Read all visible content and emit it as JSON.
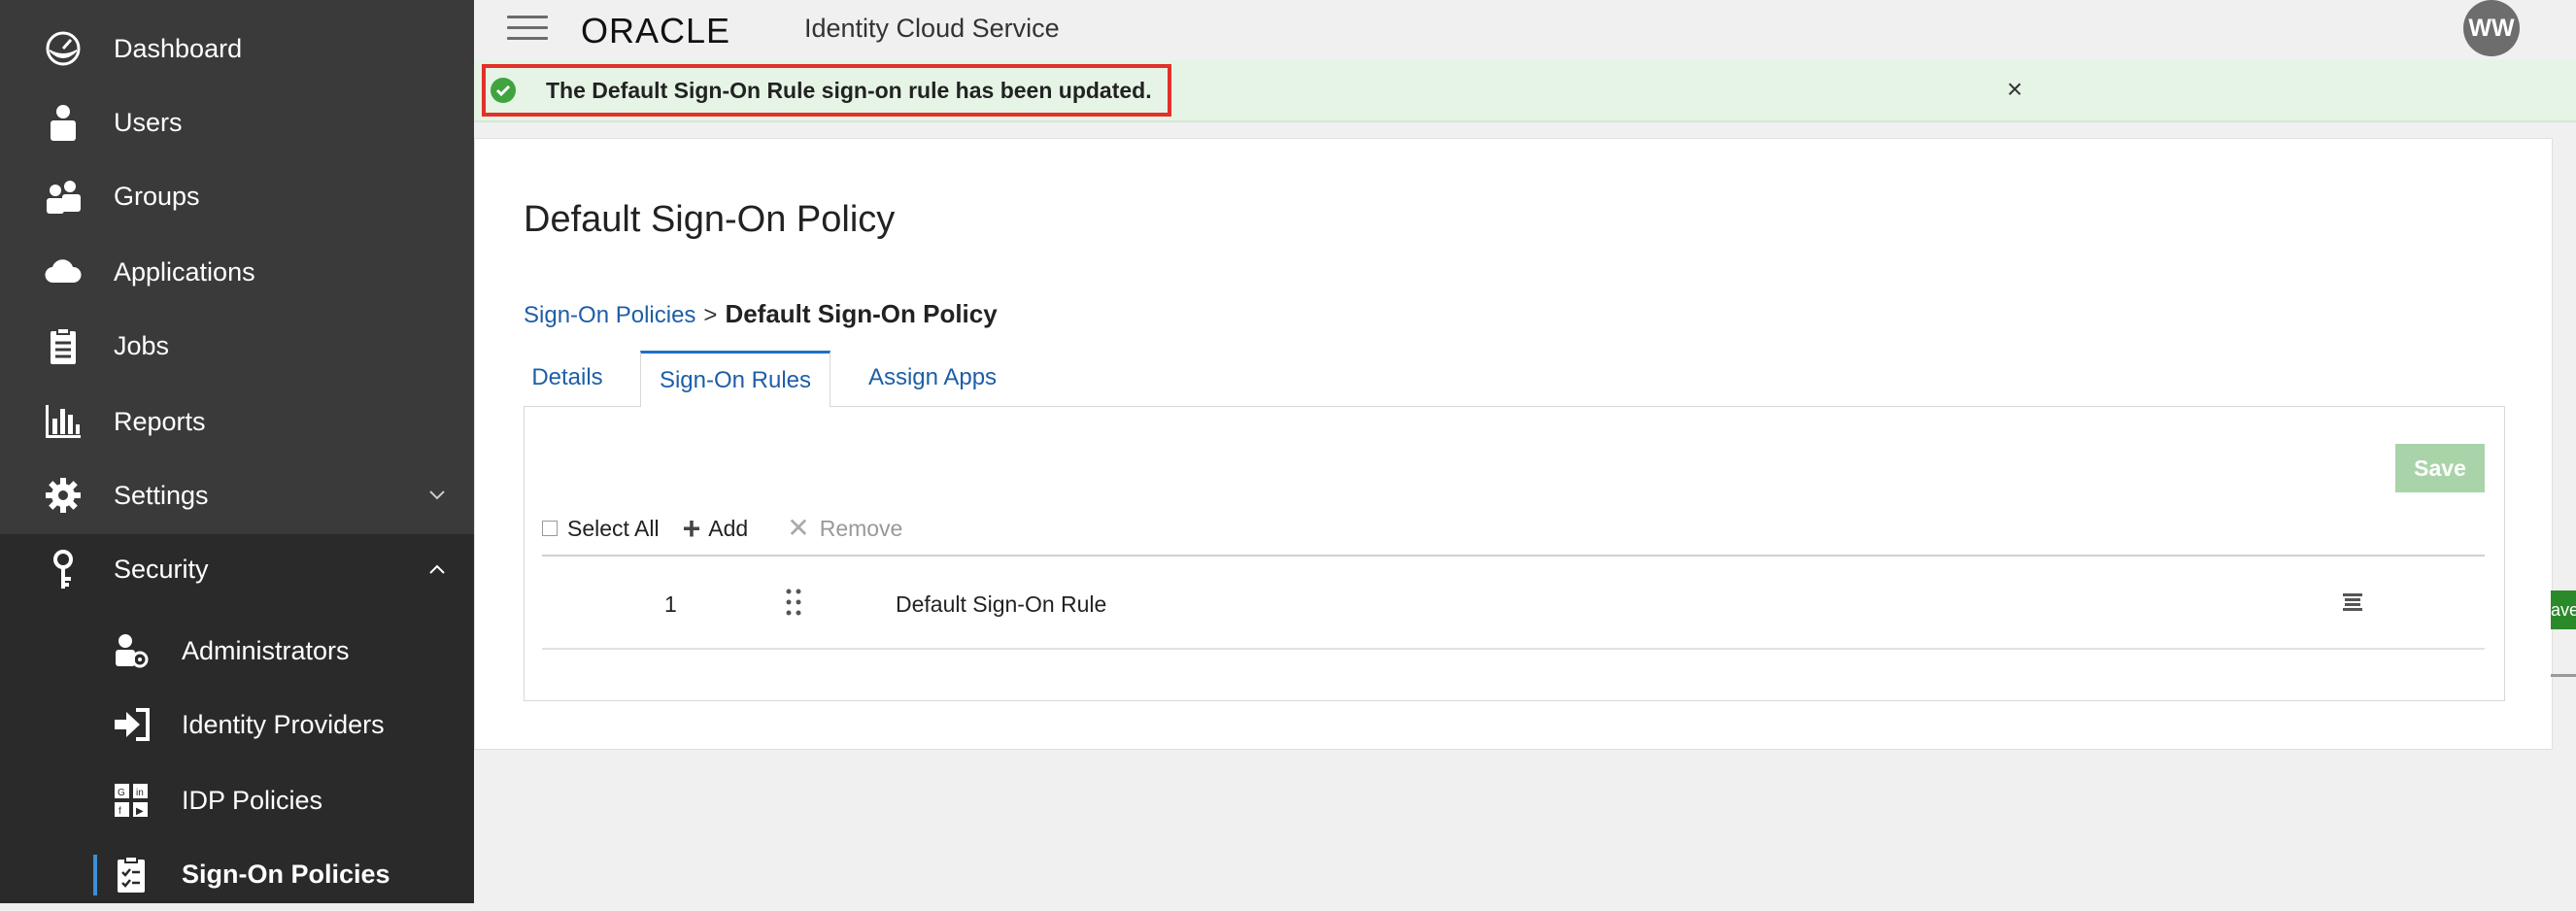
{
  "header": {
    "brand": "ORACLE",
    "app_name": "Identity Cloud Service",
    "avatar_initials": "WW"
  },
  "notification": {
    "message": "The Default Sign-On Rule sign-on rule has been updated.",
    "close": "×"
  },
  "sidebar": {
    "items": [
      {
        "label": "Dashboard",
        "icon": "dashboard-icon"
      },
      {
        "label": "Users",
        "icon": "user-icon"
      },
      {
        "label": "Groups",
        "icon": "groups-icon"
      },
      {
        "label": "Applications",
        "icon": "cloud-icon"
      },
      {
        "label": "Jobs",
        "icon": "jobs-icon"
      },
      {
        "label": "Reports",
        "icon": "reports-icon"
      },
      {
        "label": "Settings",
        "icon": "gear-icon"
      },
      {
        "label": "Security",
        "icon": "key-icon"
      }
    ],
    "security_items": [
      {
        "label": "Administrators",
        "icon": "admin-icon"
      },
      {
        "label": "Identity Providers",
        "icon": "sign-in-icon"
      },
      {
        "label": "IDP Policies",
        "icon": "idp-policies-icon"
      },
      {
        "label": "Sign-On Policies",
        "icon": "checklist-icon",
        "active": true
      }
    ]
  },
  "page": {
    "title": "Default Sign-On Policy",
    "breadcrumb": {
      "parent": "Sign-On Policies",
      "separator": ">",
      "current": "Default Sign-On Policy"
    },
    "tabs": [
      {
        "label": "Details"
      },
      {
        "label": "Sign-On Rules",
        "active": true
      },
      {
        "label": "Assign Apps"
      }
    ],
    "toolbar": {
      "save_label": "Save",
      "select_all_label": "Select All",
      "add_label": "Add",
      "remove_label": "Remove"
    },
    "rules": [
      {
        "order": "1",
        "name": "Default Sign-On Rule"
      }
    ]
  },
  "edge_fragment": "ave",
  "colors": {
    "sidebar_bg": "#3a3a3a",
    "security_bg": "#2a2a2a",
    "notice_bg": "#e6f4e6",
    "link": "#1e5ea8",
    "save_disabled": "#a9d4a9",
    "highlight": "#e2302a"
  }
}
